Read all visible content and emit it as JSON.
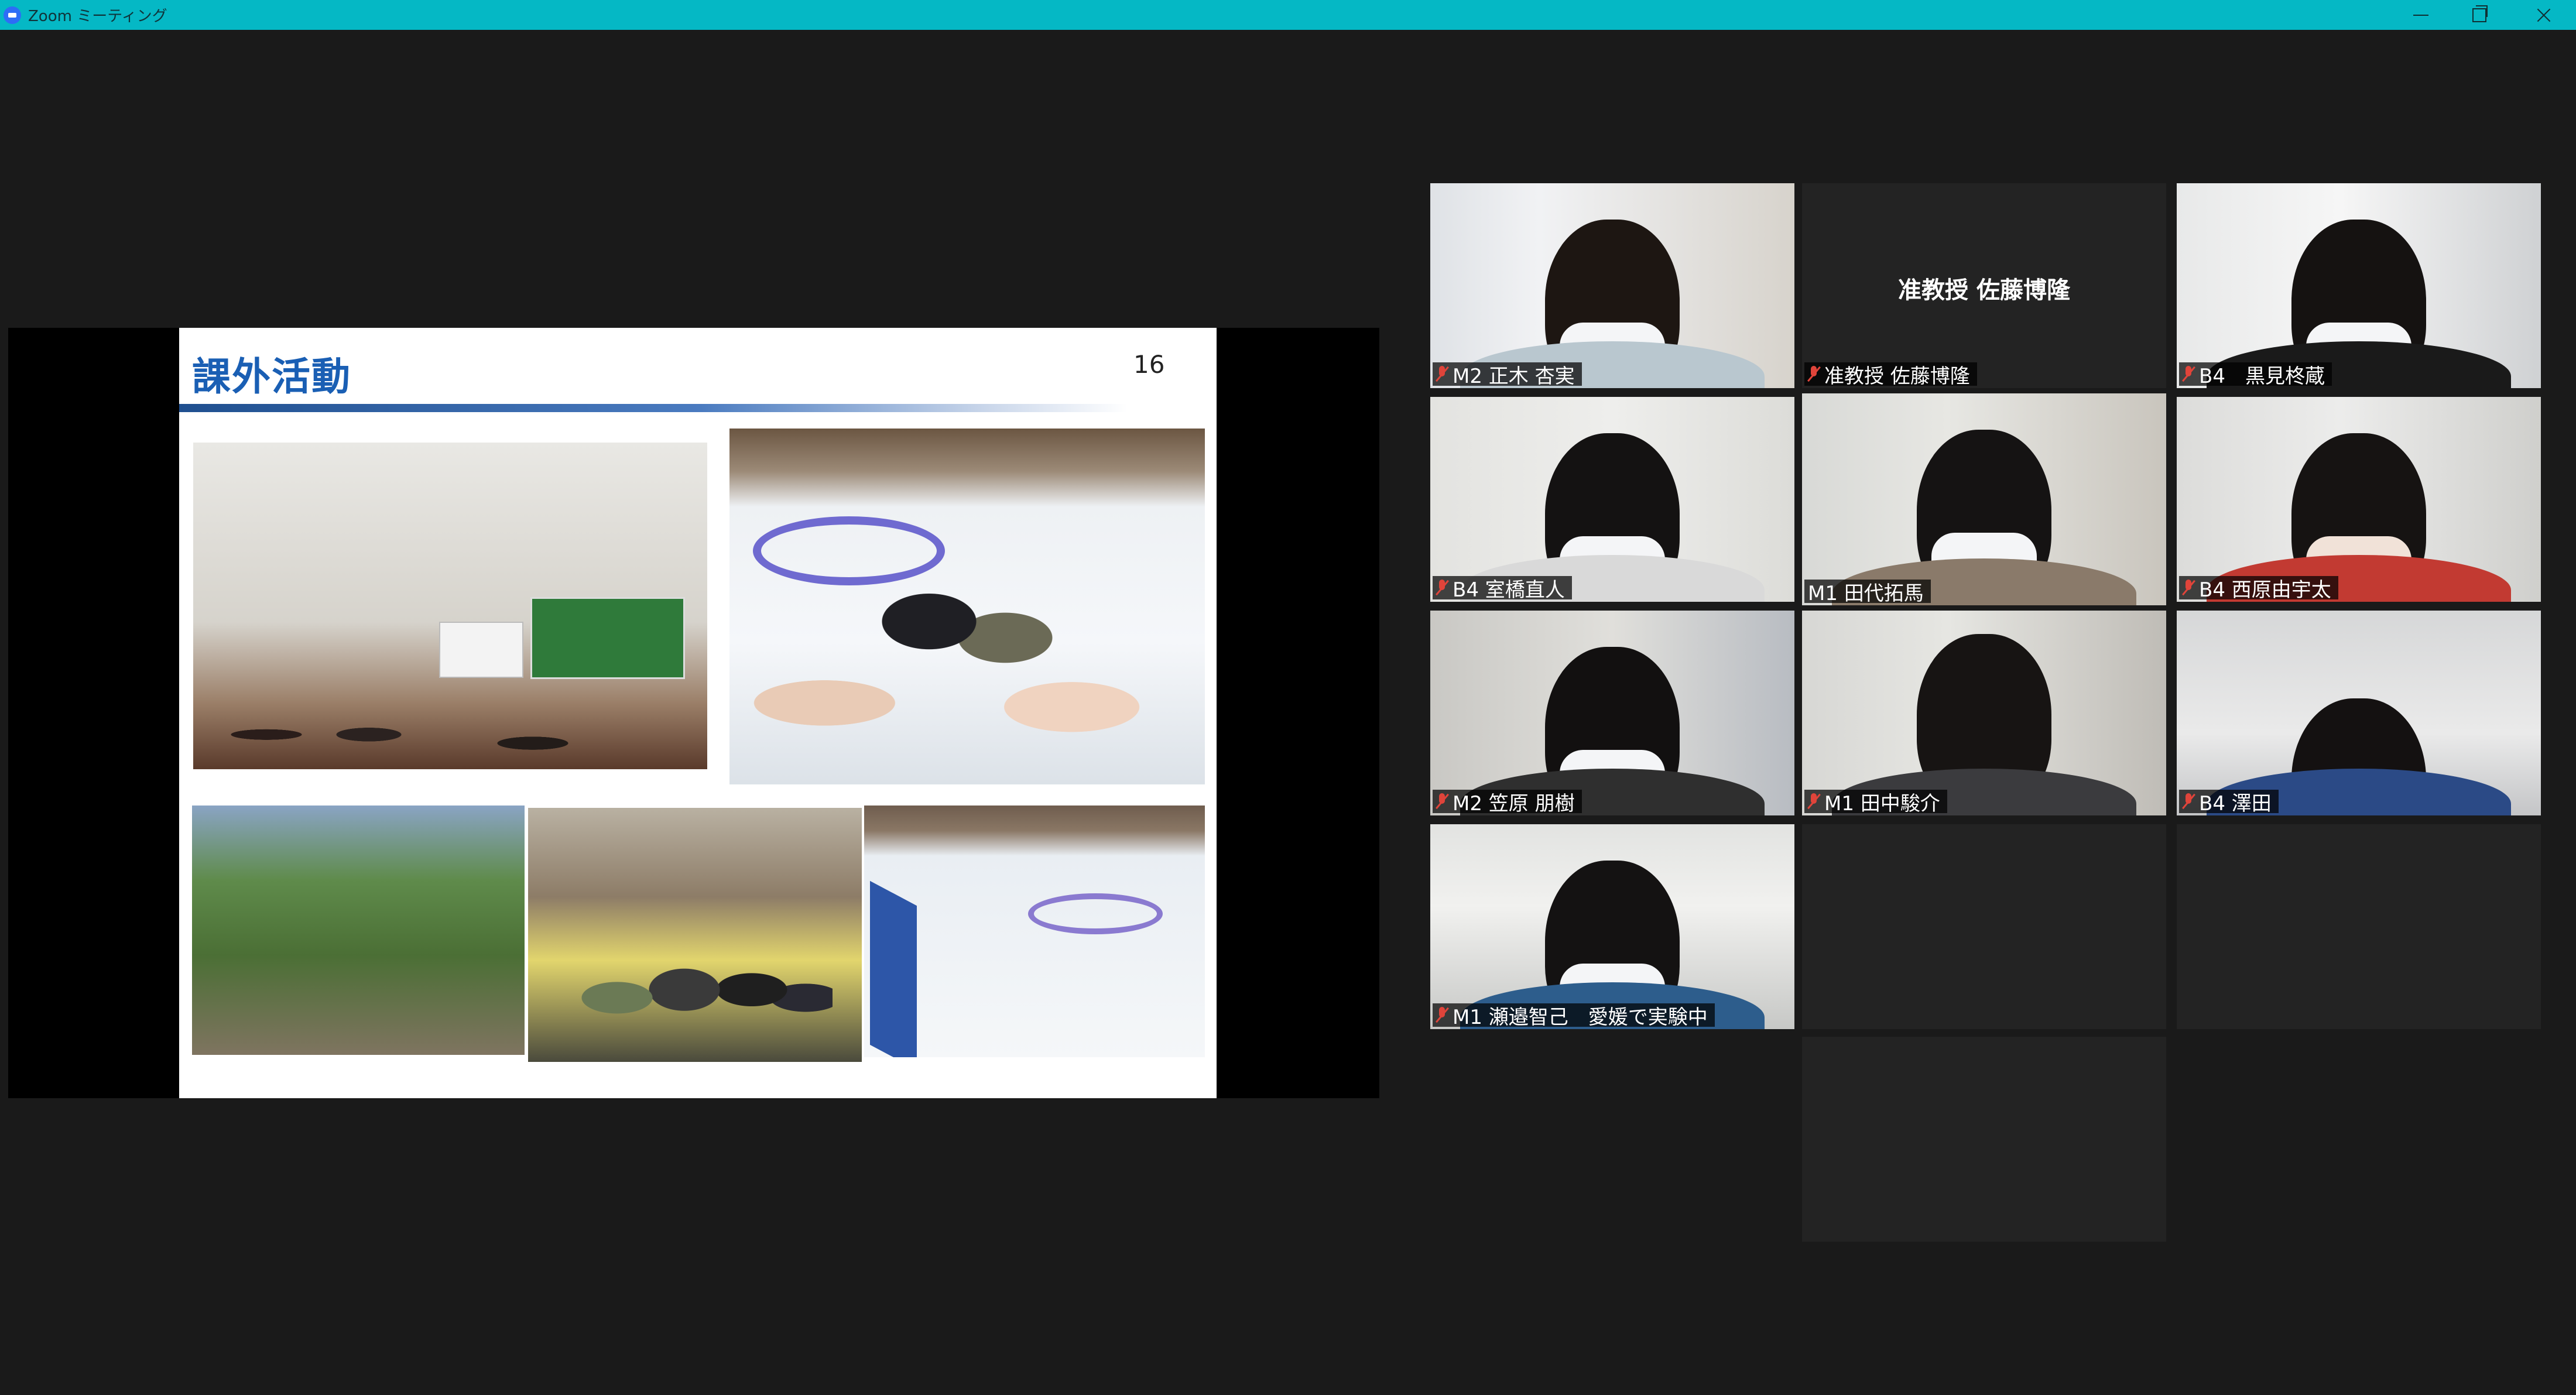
{
  "window": {
    "title": "Zoom ミーティング",
    "controls": {
      "minimize": "minimize-icon",
      "restore": "restore-icon",
      "close": "close-icon"
    }
  },
  "slide": {
    "title": "課外活動",
    "page_number": "16",
    "photos": [
      "room-photo",
      "skating-selfie-photo",
      "garden-photo",
      "group-photo",
      "ice-rink-photo"
    ]
  },
  "participants": [
    {
      "name": "M2 正木 杏実",
      "muted": true
    },
    {
      "name": "准教授 佐藤博隆",
      "display_name": "准教授 佐藤博隆",
      "video": false,
      "muted": true
    },
    {
      "name": "B4　黒見柊蔵",
      "muted": true
    },
    {
      "name": "B4 室橋直人",
      "muted": true
    },
    {
      "name": "M1 田代拓馬",
      "active_speaker": true,
      "muted": false
    },
    {
      "name": "B4 西原由宇太",
      "muted": true
    },
    {
      "name": "M2 笠原 朋樹",
      "muted": true
    },
    {
      "name": "M1 田中駿介",
      "muted": true
    },
    {
      "name": "B4 澤田",
      "muted": true
    },
    {
      "name": "M1 瀬邉智己　愛媛で実験中",
      "muted": true
    }
  ],
  "colors": {
    "titlebar": "#05b8c5",
    "background": "#1a1a1a",
    "active_speaker_border": "#e6e44c",
    "slide_title": "#1a5fb4",
    "muted_icon": "#e0443a"
  }
}
